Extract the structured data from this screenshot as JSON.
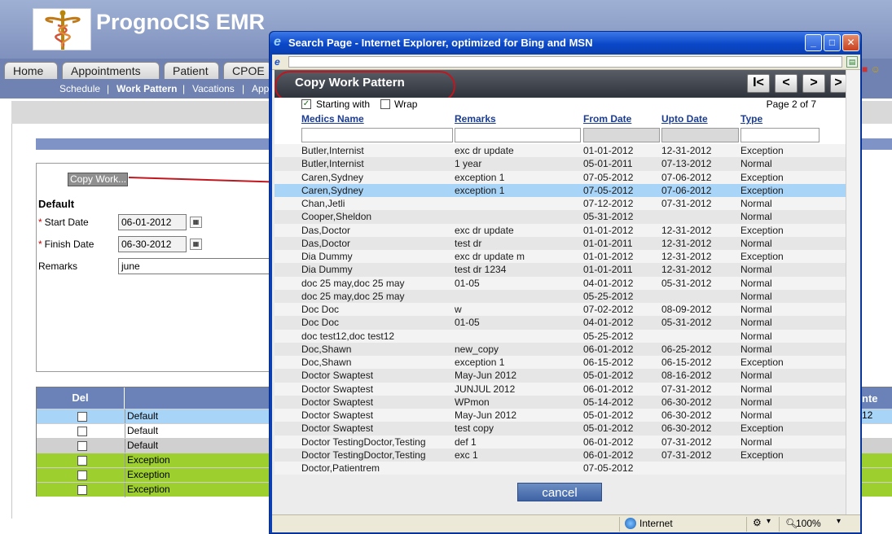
{
  "app": {
    "title": "PrognoCIS EMR",
    "tabs": [
      "Home",
      "Appointments",
      "Patient",
      "CPOE"
    ],
    "subnav": [
      "Schedule",
      "|",
      "Work Pattern",
      "|",
      "Vacations",
      "|",
      "App"
    ],
    "copy_work_label": "Copy Work...",
    "section_title": "Default",
    "start_date_label": "Start Date",
    "start_date_value": "06-01-2012",
    "finish_date_label": "Finish Date",
    "finish_date_value": "06-30-2012",
    "remarks_label": "Remarks",
    "remarks_value": "june",
    "required_mark": "*",
    "grid_del_header": "Del",
    "grid_rows": [
      "Default",
      "Default",
      "Default",
      "Exception",
      "Exception",
      "Exception"
    ],
    "grid_right_header_fragment": "nte",
    "grid_right_cell_fragment": "12",
    "colors": {
      "row_blue": "#a8d4f8",
      "row_grey": "#d0d0d0",
      "row_green": "#9dcf2e",
      "header_blue": "#6a82b8"
    }
  },
  "window": {
    "title": "Search Page - Internet Explorer, optimized for Bing and MSN",
    "status_zone": "Internet",
    "zoom": "100%"
  },
  "dialog": {
    "title": "Copy Work Pattern",
    "pager": [
      "I<",
      "<",
      ">",
      ">"
    ],
    "starting_with_label": "Starting with",
    "starting_with_checked": true,
    "wrap_label": "Wrap",
    "wrap_checked": false,
    "page_label": "Page 2 of 7",
    "columns": [
      "Medics Name",
      "Remarks",
      "From Date",
      "Upto Date",
      "Type"
    ],
    "rows": [
      [
        "Butler,Internist",
        "exc dr update",
        "01-01-2012",
        "12-31-2012",
        "Exception"
      ],
      [
        "Butler,Internist",
        "1 year",
        "05-01-2011",
        "07-13-2012",
        "Normal"
      ],
      [
        "Caren,Sydney",
        "exception 1",
        "07-05-2012",
        "07-06-2012",
        "Exception"
      ],
      [
        "Caren,Sydney",
        "exception 1",
        "07-05-2012",
        "07-06-2012",
        "Exception"
      ],
      [
        "Chan,Jetli",
        "",
        "07-12-2012",
        "07-31-2012",
        "Normal"
      ],
      [
        "Cooper,Sheldon",
        "",
        "05-31-2012",
        "",
        "Normal"
      ],
      [
        "Das,Doctor",
        "exc dr update",
        "01-01-2012",
        "12-31-2012",
        "Exception"
      ],
      [
        "Das,Doctor",
        "test dr",
        "01-01-2011",
        "12-31-2012",
        "Normal"
      ],
      [
        "Dia Dummy",
        "exc dr update m",
        "01-01-2012",
        "12-31-2012",
        "Exception"
      ],
      [
        "Dia Dummy",
        "test dr 1234",
        "01-01-2011",
        "12-31-2012",
        "Normal"
      ],
      [
        "doc 25 may,doc 25 may",
        "01-05",
        "04-01-2012",
        "05-31-2012",
        "Normal"
      ],
      [
        "doc 25 may,doc 25 may",
        "",
        "05-25-2012",
        "",
        "Normal"
      ],
      [
        "Doc Doc",
        "w",
        "07-02-2012",
        "08-09-2012",
        "Normal"
      ],
      [
        "Doc Doc",
        "01-05",
        "04-01-2012",
        "05-31-2012",
        "Normal"
      ],
      [
        "doc test12,doc test12",
        "",
        "05-25-2012",
        "",
        "Normal"
      ],
      [
        "Doc,Shawn",
        "new_copy",
        "06-01-2012",
        "06-25-2012",
        "Normal"
      ],
      [
        "Doc,Shawn",
        "exception 1",
        "06-15-2012",
        "06-15-2012",
        "Exception"
      ],
      [
        "Doctor Swaptest",
        "May-Jun 2012",
        "05-01-2012",
        "08-16-2012",
        "Normal"
      ],
      [
        "Doctor Swaptest",
        "JUNJUL 2012",
        "06-01-2012",
        "07-31-2012",
        "Normal"
      ],
      [
        "Doctor Swaptest",
        "WPmon",
        "05-14-2012",
        "06-30-2012",
        "Normal"
      ],
      [
        "Doctor Swaptest",
        "May-Jun 2012",
        "05-01-2012",
        "06-30-2012",
        "Normal"
      ],
      [
        "Doctor Swaptest",
        "test copy",
        "05-01-2012",
        "06-30-2012",
        "Exception"
      ],
      [
        "Doctor TestingDoctor,Testing",
        "def 1",
        "06-01-2012",
        "07-31-2012",
        "Normal"
      ],
      [
        "Doctor TestingDoctor,Testing",
        "exc 1",
        "06-01-2012",
        "07-31-2012",
        "Exception"
      ],
      [
        "Doctor,Patientrem",
        "",
        "07-05-2012",
        "",
        ""
      ]
    ],
    "selected_row": 3,
    "cancel_label": "cancel"
  }
}
